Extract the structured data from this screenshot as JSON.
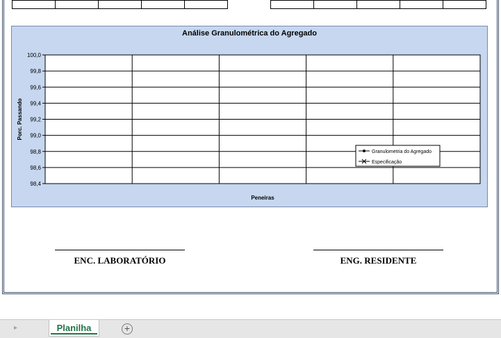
{
  "chart_data": {
    "type": "line",
    "title": "Análise Granulométrica do Agregado",
    "xlabel": "Peneiras",
    "ylabel": "Porc. Passando",
    "ylim": [
      98.4,
      100.0
    ],
    "y_ticks": [
      "100,0",
      "99,8",
      "99,6",
      "99,4",
      "99,2",
      "99,0",
      "98,8",
      "98,6",
      "98,4"
    ],
    "x_ticks": [],
    "x_gridlines": 5,
    "grid": true,
    "legend_position": "right",
    "series": [
      {
        "name": "Granulometria do Agregado",
        "marker": "dot",
        "values": []
      },
      {
        "name": "Especificação",
        "marker": "x",
        "values": []
      }
    ],
    "colors": {
      "background": "#c6d7ef",
      "plot": "#ffffff",
      "line": "#000000"
    }
  },
  "signatures": {
    "left_label": "ENC. LABORATÓRIO",
    "right_label": "ENG. RESIDENTE"
  },
  "tabs": {
    "active_sheet": "Planilha",
    "add_symbol": "+",
    "nav_symbol": "▸"
  }
}
